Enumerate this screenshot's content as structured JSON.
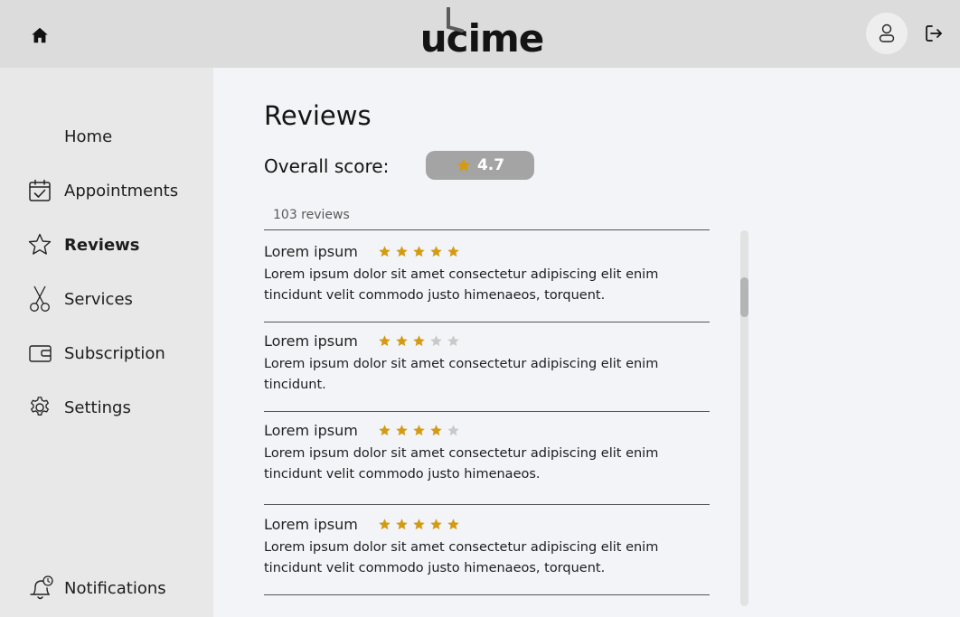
{
  "header": {
    "logo_text": "ucime"
  },
  "sidebar": {
    "items": [
      {
        "label": "Home",
        "icon": "none"
      },
      {
        "label": "Appointments",
        "icon": "calendar-check-icon"
      },
      {
        "label": "Reviews",
        "icon": "star-outline-icon",
        "active": true
      },
      {
        "label": "Services",
        "icon": "scissors-icon"
      },
      {
        "label": "Subscription",
        "icon": "wallet-icon"
      },
      {
        "label": "Settings",
        "icon": "gear-icon"
      }
    ],
    "notifications_label": "Notifications"
  },
  "main": {
    "title": "Reviews",
    "overall_score_label": "Overall score:",
    "overall_score_value": "4.7",
    "review_count": "103 reviews",
    "reviews": [
      {
        "name": "Lorem ipsum",
        "rating": 5,
        "text": "Lorem ipsum dolor sit amet consectetur adipiscing elit enim tincidunt velit commodo justo himenaeos, torquent."
      },
      {
        "name": "Lorem ipsum",
        "rating": 3,
        "text": "Lorem ipsum dolor sit amet consectetur adipiscing elit enim tincidunt."
      },
      {
        "name": "Lorem ipsum",
        "rating": 4,
        "text": "Lorem ipsum dolor sit amet consectetur adipiscing elit enim tincidunt velit commodo justo himenaeos."
      },
      {
        "name": "Lorem ipsum",
        "rating": 5,
        "text": "Lorem ipsum dolor sit amet consectetur adipiscing elit enim tincidunt velit commodo justo himenaeos, torquent."
      }
    ]
  },
  "colors": {
    "star_filled": "#d49a12",
    "star_empty": "#c9c9c9",
    "score_pill": "#a4a4a4",
    "header_bg": "#dcdcdc",
    "sidebar_bg": "#e8e8e8",
    "main_bg": "#f3f4f7"
  }
}
